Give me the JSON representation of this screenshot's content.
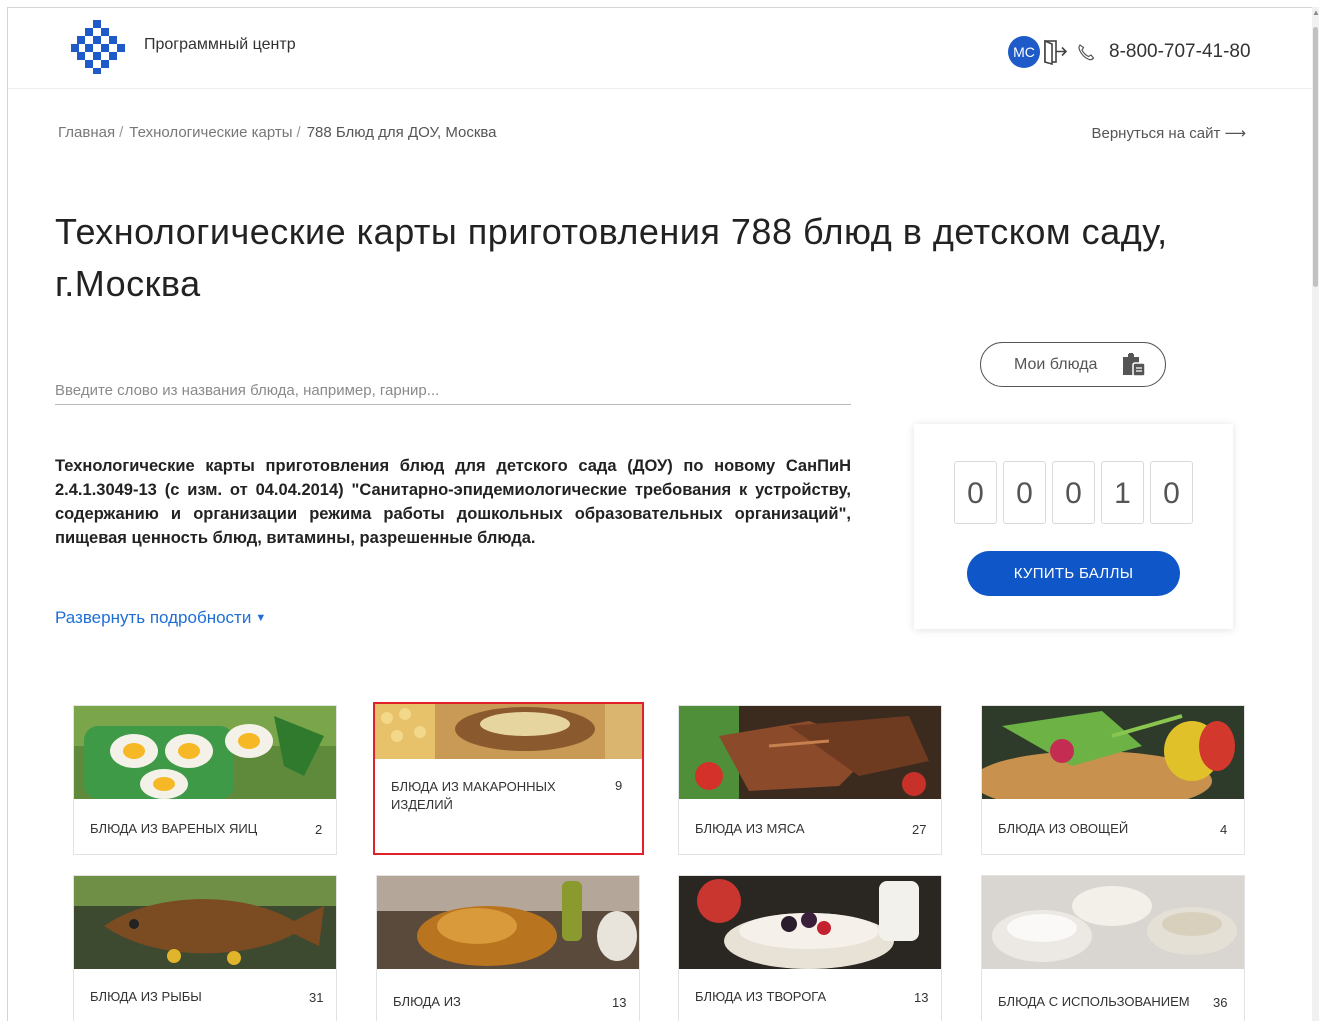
{
  "header": {
    "brand": "Программный центр",
    "avatar_initials": "МС",
    "phone": "8-800-707-41-80",
    "icons": [
      "logo-icon",
      "exit-icon",
      "phone-icon"
    ]
  },
  "breadcrumb": {
    "items": [
      "Главная",
      "Технологические карты"
    ],
    "current": "788 Блюд для ДОУ, Москва",
    "back_link": "Вернуться на сайт ⟶"
  },
  "title": "Технологические карты приготовления 788 блюд в детском саду, г.Москва",
  "search": {
    "placeholder": "Введите слово из названия блюда, например, гарнир..."
  },
  "my_dishes": {
    "label": "Мои блюда",
    "icon": "clipboard-icon"
  },
  "points": {
    "digits": [
      "0",
      "0",
      "0",
      "1",
      "0"
    ],
    "buy_label": "КУПИТЬ БАЛЛЫ"
  },
  "description": "Технологические карты приготовления блюд для детского сада (ДОУ) по новому СанПиН 2.4.1.3049-13 (с изм. от 04.04.2014) \"Санитарно-эпидемиологические требования к устройству, содержанию и организации режима работы дошкольных образовательных организаций\", пищевая ценность блюд, витамины, разрешенные блюда.",
  "expand_label": "Развернуть подробности",
  "categories": [
    {
      "name": "Блюда из вареных яиц",
      "count": "2"
    },
    {
      "name": "Блюда из макаронных изделий",
      "count": "9"
    },
    {
      "name": "Блюда из мяса",
      "count": "27"
    },
    {
      "name": "Блюда из овощей",
      "count": "4"
    },
    {
      "name": "Блюда из рыбы",
      "count": "31"
    },
    {
      "name": "Блюда из",
      "count": "13"
    },
    {
      "name": "Блюда из творога",
      "count": "13"
    },
    {
      "name": "Блюда с использованием",
      "count": "36"
    }
  ],
  "colors": {
    "accent": "#0f57c9",
    "link": "#1e6ed6",
    "selection": "#e2202a"
  }
}
